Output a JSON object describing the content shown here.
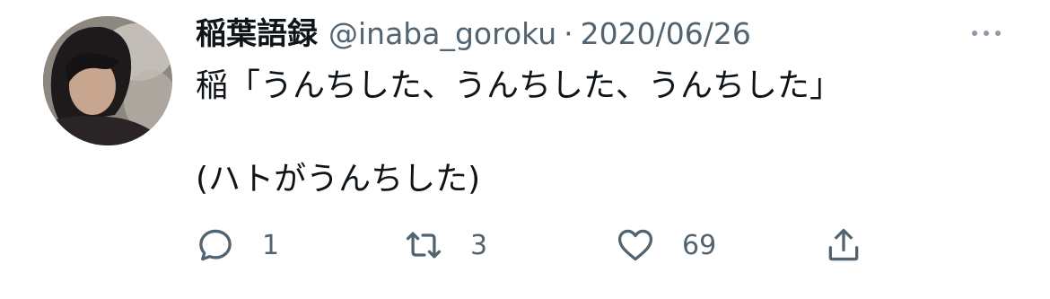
{
  "tweet": {
    "author_name": "稲葉語録",
    "handle": "@inaba_goroku",
    "separator": "·",
    "date": "2020/06/26",
    "text_line1": "稲「うんちした、うんちした、うんちした」",
    "text_line2": "(ハトがうんちした)"
  },
  "actions": {
    "reply_count": "1",
    "retweet_count": "3",
    "like_count": "69"
  },
  "icons": {
    "more": "more-horizontal-icon",
    "reply": "reply-icon",
    "retweet": "retweet-icon",
    "like": "heart-icon",
    "share": "share-icon"
  },
  "colors": {
    "text": "#0f1419",
    "secondary": "#536471",
    "background": "#ffffff"
  }
}
